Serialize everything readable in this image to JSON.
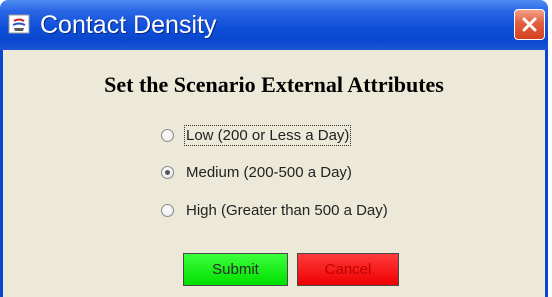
{
  "window": {
    "title": "Contact Density",
    "close_icon": "close-icon",
    "app_icon": "java-app-icon"
  },
  "dialog": {
    "heading": "Set the Scenario External Attributes",
    "options": [
      {
        "label": "Low (200 or Less a Day)",
        "selected": false,
        "focused": true
      },
      {
        "label": "Medium (200-500 a Day)",
        "selected": true,
        "focused": false
      },
      {
        "label": "High (Greater than 500 a Day)",
        "selected": false,
        "focused": false
      }
    ],
    "submit_label": "Submit",
    "cancel_label": "Cancel"
  },
  "colors": {
    "titlebar": "#0a47cf",
    "body": "#ece9d8",
    "submit_bg": "#00e000",
    "cancel_bg": "#ee0000"
  }
}
